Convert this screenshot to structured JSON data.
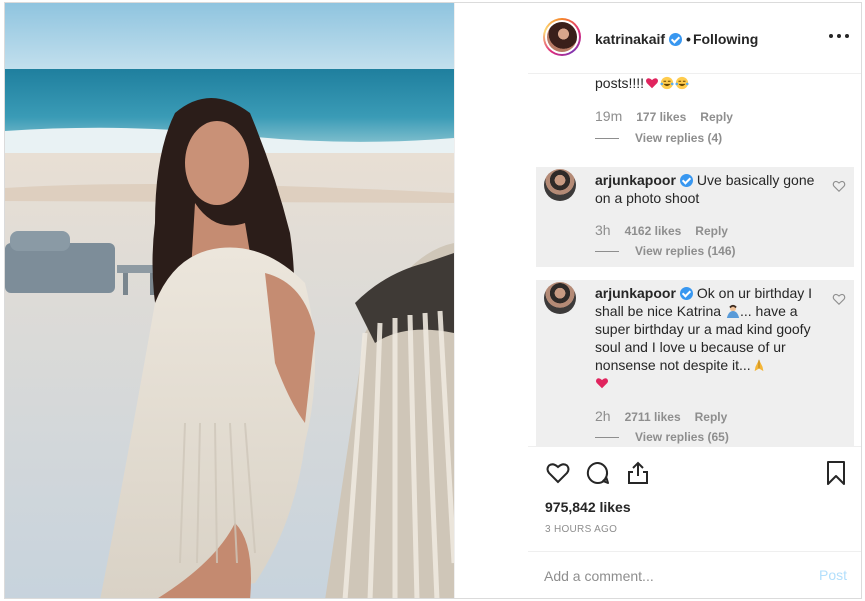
{
  "post": {
    "username": "katrinakaif",
    "follow_state": "Following",
    "likes": "975,842 likes",
    "time_ago": "3 HOURS AGO"
  },
  "comments": [
    {
      "text": "posts!!!!",
      "emojis": [
        "red-heart",
        "tears-of-joy",
        "tears-of-joy"
      ],
      "time": "19m",
      "likes": "177 likes",
      "reply": "Reply",
      "view_replies": "View replies (4)"
    },
    {
      "username": "arjunkapoor",
      "text": "Uve basically gone on a photo shoot",
      "time": "3h",
      "likes": "4162 likes",
      "reply": "Reply",
      "view_replies": "View replies (146)"
    },
    {
      "username": "arjunkapoor",
      "text_a": "Ok on ur birthday I shall be nice Katrina",
      "text_b": "... have a super birthday ur a mad kind goofy soul and I love u because of ur nonsense not despite it...",
      "emojis": [
        "person-bowing",
        "folded-hands",
        "red-heart"
      ],
      "time": "2h",
      "likes": "2711 likes",
      "reply": "Reply",
      "view_replies": "View replies (65)"
    }
  ],
  "add_comment": {
    "placeholder": "Add a comment...",
    "post_label": "Post"
  },
  "icons": {
    "like": "heart-outline-icon",
    "comment": "speech-bubble-icon",
    "share": "share-upload-icon",
    "save": "bookmark-icon",
    "more": "more-options-icon"
  },
  "colors": {
    "verified": "#3897f0",
    "heart": "#ed4956",
    "post_button_disabled": "#b2dffc",
    "reply_highlight": "#efefef"
  }
}
